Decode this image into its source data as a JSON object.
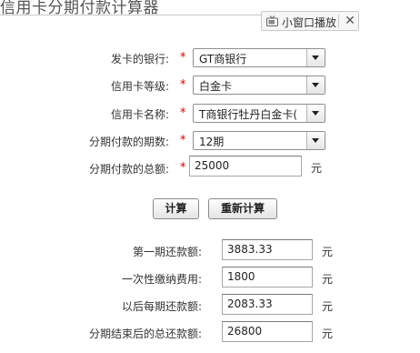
{
  "page": {
    "title": "信用卡分期付款计算器"
  },
  "mini_window": {
    "label": "小窗口播放",
    "close": "✕"
  },
  "form": {
    "bank": {
      "label": "发卡的银行:",
      "value": "GT商银行"
    },
    "level": {
      "label": "信用卡等级:",
      "value": "白金卡"
    },
    "card_name": {
      "label": "信用卡名称:",
      "value": "T商银行牡丹白金卡("
    },
    "periods": {
      "label": "分期付款的期数:",
      "value": "12期"
    },
    "total": {
      "label": "分期付款的总额:",
      "value": "25000",
      "unit": "元"
    },
    "required_mark": "*"
  },
  "buttons": {
    "calculate": "计算",
    "recalculate": "重新计算"
  },
  "results": {
    "first_payment": {
      "label": "第一期还款额:",
      "value": "3883.33",
      "unit": "元"
    },
    "fee": {
      "label": "一次性缴纳费用:",
      "value": "1800",
      "unit": "元"
    },
    "later_payment": {
      "label": "以后每期还款额:",
      "value": "2083.33",
      "unit": "元"
    },
    "total_after": {
      "label": "分期结束后的总还款额:",
      "value": "26800",
      "unit": "元"
    }
  },
  "colors": {
    "required": "#d40000",
    "border": "#8f8f8f"
  }
}
